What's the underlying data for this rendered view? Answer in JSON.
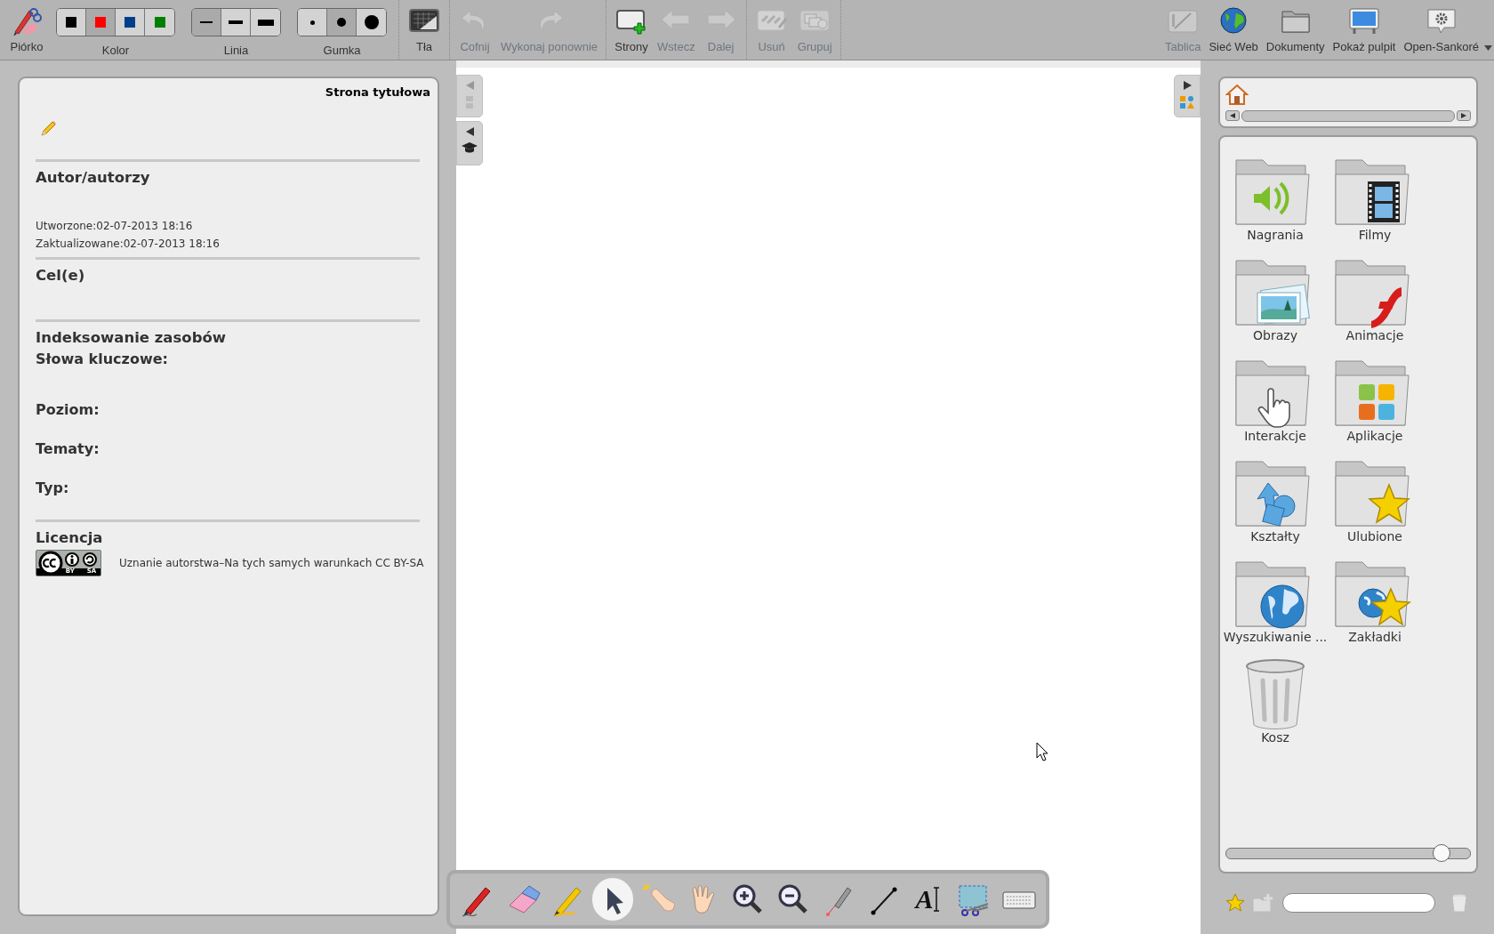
{
  "toolbar": {
    "groups": [
      {
        "items": [
          {
            "kind": "tool",
            "label": "Piórko",
            "disabled": false
          },
          {
            "kind": "swatches",
            "label": "Kolor",
            "options": [
              {
                "color": "#000000",
                "selected": false
              },
              {
                "color": "#ff0000",
                "selected": true
              },
              {
                "color": "#003f8a",
                "selected": false
              },
              {
                "color": "#008000",
                "selected": false
              }
            ]
          },
          {
            "kind": "line_widths",
            "label": "Linia",
            "options": [
              {
                "selected": true
              },
              {
                "selected": false
              },
              {
                "selected": false
              }
            ]
          },
          {
            "kind": "eraser_sizes",
            "label": "Gumka",
            "options": [
              {
                "selected": false
              },
              {
                "selected": true
              },
              {
                "selected": false
              }
            ]
          }
        ]
      },
      {
        "items": [
          {
            "kind": "tool",
            "label": "Tła",
            "disabled": false
          }
        ]
      },
      {
        "items": [
          {
            "kind": "tool",
            "label": "Cofnij",
            "disabled": true
          },
          {
            "kind": "tool",
            "label": "Wykonaj ponownie",
            "disabled": true
          }
        ]
      },
      {
        "items": [
          {
            "kind": "tool",
            "label": "Strony",
            "disabled": false
          },
          {
            "kind": "tool",
            "label": "Wstecz",
            "disabled": true
          },
          {
            "kind": "tool",
            "label": "Dalej",
            "disabled": true
          }
        ]
      },
      {
        "items": [
          {
            "kind": "tool",
            "label": "Usuń",
            "disabled": true
          },
          {
            "kind": "tool",
            "label": "Grupuj",
            "disabled": true
          }
        ]
      }
    ],
    "right_items": [
      {
        "label": "Tablica",
        "disabled": true
      },
      {
        "label": "Sieć Web",
        "disabled": false
      },
      {
        "label": "Dokumenty",
        "disabled": false
      },
      {
        "label": "Pokaż pulpit",
        "disabled": false
      },
      {
        "label": "Open-Sankoré",
        "disabled": false
      }
    ]
  },
  "document_panel": {
    "title": "Strona tytułowa",
    "sections": [
      {
        "kind": "authors",
        "heading": "Autor/autorzy",
        "lines": [
          "Utworzone:02-07-2013 18:16",
          "Zaktualizowane:02-07-2013 18:16"
        ]
      },
      {
        "kind": "goals",
        "heading": "Cel(e)"
      },
      {
        "kind": "indexing",
        "heading": "Indeksowanie zasobów",
        "fields": [
          "Słowa kluczowe:",
          "Poziom:",
          "Tematy:",
          "Typ:"
        ]
      },
      {
        "kind": "license",
        "heading": "Licencja",
        "badge_labels": [
          "BY",
          "SA"
        ],
        "license_text": "Uznanie autorstwa–Na tych samych warunkach CC BY-SA"
      }
    ]
  },
  "tool_dock": {
    "tools": [
      {
        "selected": false
      },
      {
        "selected": false
      },
      {
        "selected": false
      },
      {
        "selected": true
      },
      {
        "selected": false
      },
      {
        "selected": false
      },
      {
        "selected": false
      },
      {
        "selected": false
      },
      {
        "selected": false
      },
      {
        "selected": false
      },
      {
        "selected": false,
        "glyph": "A"
      },
      {
        "selected": false
      },
      {
        "selected": false
      }
    ]
  },
  "library": {
    "items": [
      {
        "kind": "folder",
        "label": "Nagrania"
      },
      {
        "kind": "folder",
        "label": "Filmy"
      },
      {
        "kind": "folder",
        "label": "Obrazy"
      },
      {
        "kind": "folder",
        "label": "Animacje"
      },
      {
        "kind": "folder",
        "label": "Interakcje"
      },
      {
        "kind": "folder",
        "label": "Aplikacje"
      },
      {
        "kind": "folder",
        "label": "Kształty"
      },
      {
        "kind": "folder",
        "label": "Ulubione"
      },
      {
        "kind": "folder",
        "label": "Wyszukiwanie ..."
      },
      {
        "kind": "folder",
        "label": "Zakładki"
      },
      {
        "kind": "trash",
        "label": "Kosz"
      }
    ],
    "zoom_slider": {
      "level": 0.88
    }
  }
}
